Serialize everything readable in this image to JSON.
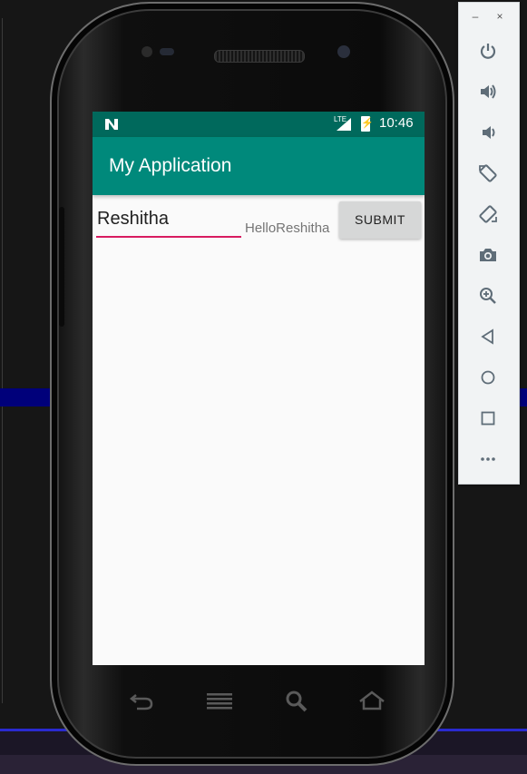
{
  "status_bar": {
    "network": "LTE",
    "time": "10:46"
  },
  "app_bar": {
    "title": "My Application"
  },
  "form": {
    "name_value": "Reshitha",
    "greeting": "HelloReshitha",
    "submit_label": "SUBMIT"
  },
  "colors": {
    "status_bar": "#00695c",
    "app_bar": "#00897b",
    "accent": "#d81b60"
  },
  "emulator_panel": {
    "window_controls": [
      "–",
      "×"
    ],
    "tools": [
      "power-icon",
      "volume-up-icon",
      "volume-down-icon",
      "rotate-left-icon",
      "rotate-right-icon",
      "screenshot-icon",
      "zoom-icon",
      "back-icon",
      "home-icon",
      "overview-icon",
      "more-icon"
    ]
  },
  "hardware_keys": [
    "back-key-icon",
    "menu-key-icon",
    "search-key-icon",
    "home-key-icon"
  ]
}
